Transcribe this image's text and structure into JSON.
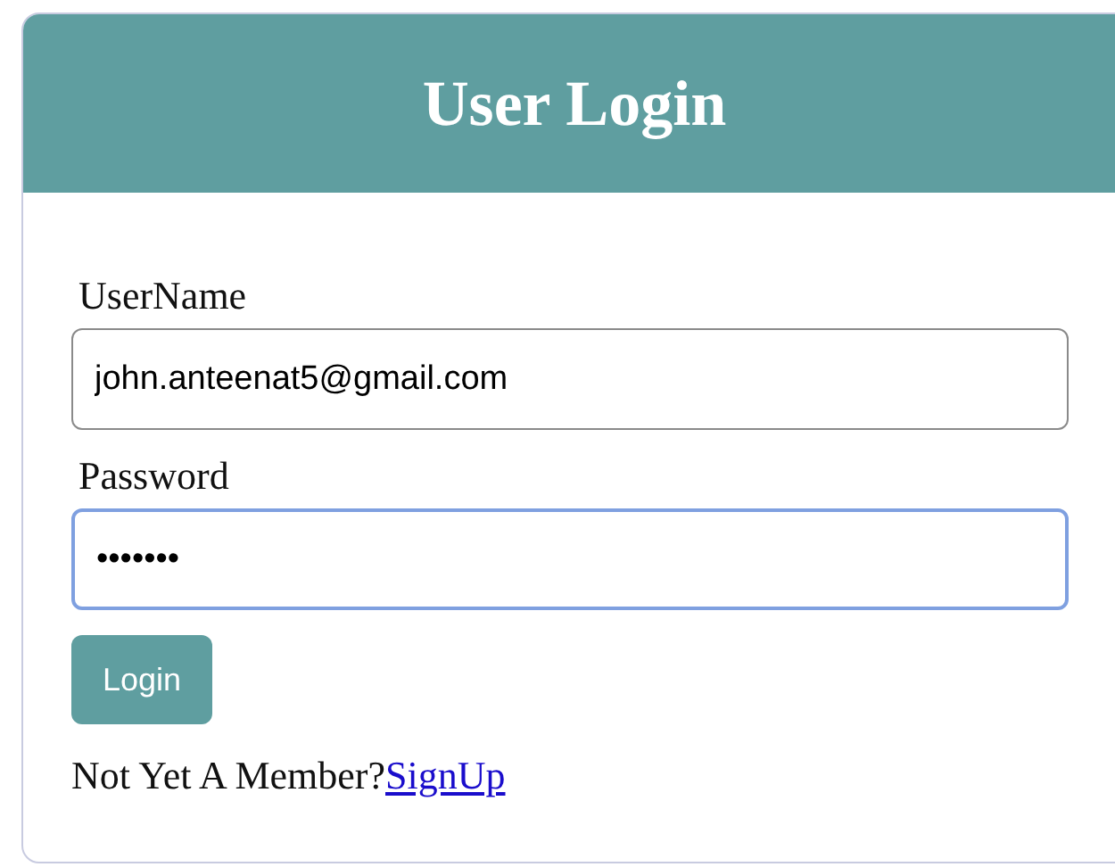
{
  "header": {
    "title": "User Login"
  },
  "fields": [
    {
      "label": "UserName",
      "value": "john.anteenat5@gmail.com",
      "focused": false
    },
    {
      "label": "Password",
      "value": "•••••••",
      "focused": true
    }
  ],
  "button": {
    "label": "Login"
  },
  "footer": {
    "text": "Not Yet A Member?",
    "link": "SignUp"
  }
}
